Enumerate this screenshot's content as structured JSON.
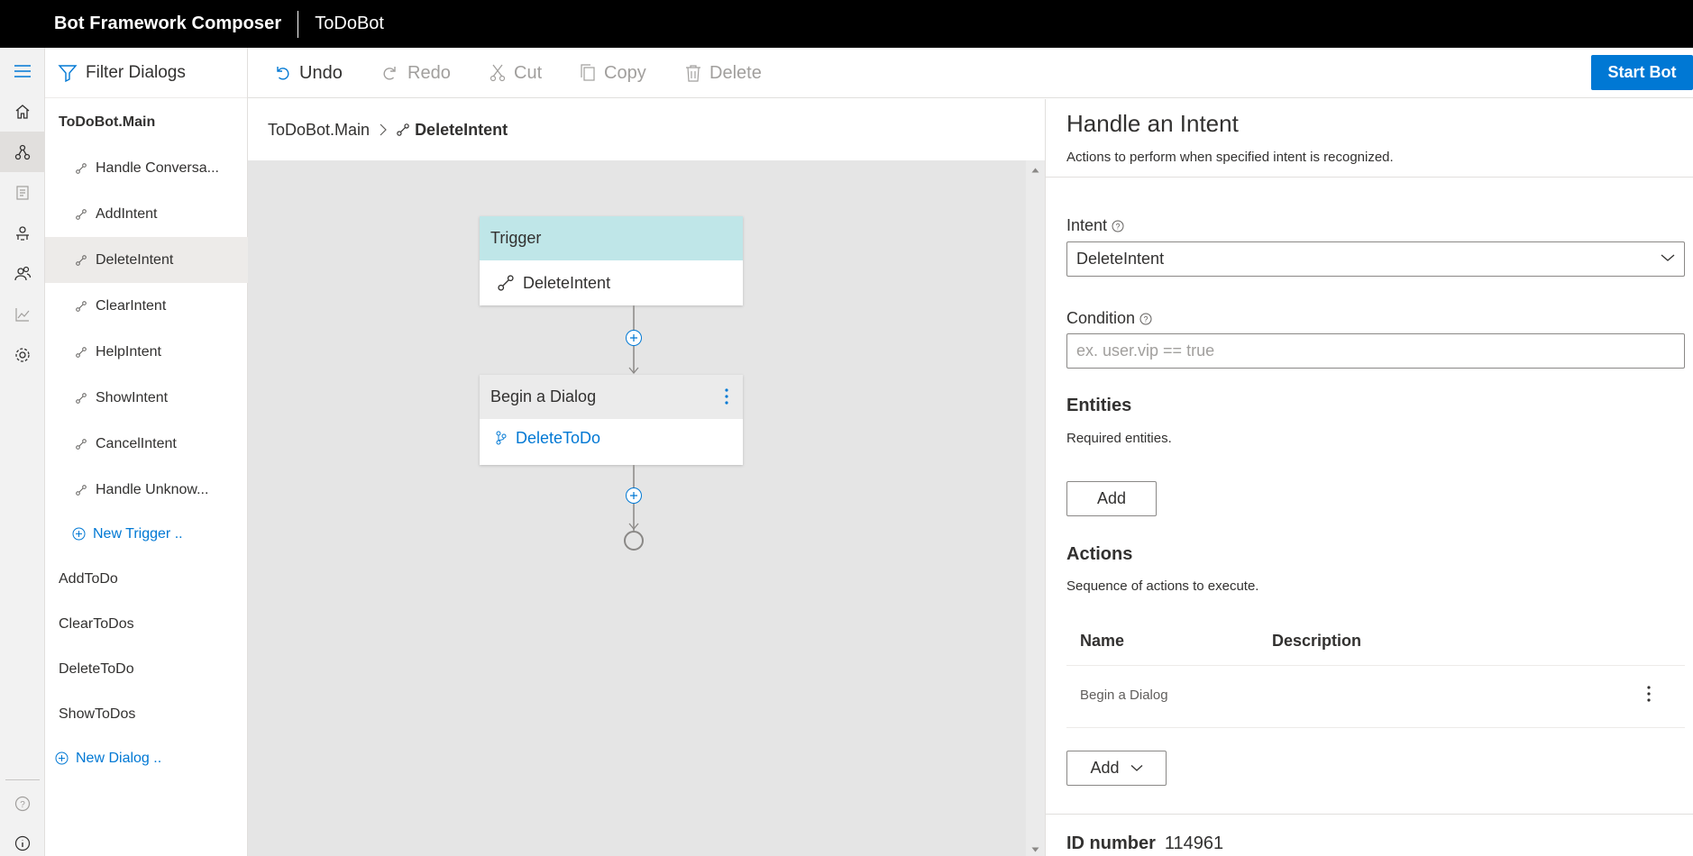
{
  "header": {
    "app_title": "Bot Framework Composer",
    "bot_name": "ToDoBot"
  },
  "rail": {
    "items": [
      "hamburger-icon",
      "home-icon",
      "flow-icon",
      "document-icon",
      "bot-icon",
      "users-icon",
      "analytics-icon",
      "settings-icon"
    ],
    "bottom": [
      "help-icon",
      "info-icon"
    ]
  },
  "tree": {
    "filter_label": "Filter Dialogs",
    "main_dialog": "ToDoBot.Main",
    "triggers": [
      "Handle Conversa...",
      "AddIntent",
      "DeleteIntent",
      "ClearIntent",
      "HelpIntent",
      "ShowIntent",
      "CancelIntent",
      "Handle Unknow..."
    ],
    "selected_trigger": "DeleteIntent",
    "new_trigger": "New Trigger ..",
    "dialogs": [
      "AddToDo",
      "ClearToDos",
      "DeleteToDo",
      "ShowToDos"
    ],
    "new_dialog": "New Dialog .."
  },
  "toolbar": {
    "undo": "Undo",
    "redo": "Redo",
    "cut": "Cut",
    "copy": "Copy",
    "delete": "Delete",
    "start_bot": "Start Bot"
  },
  "breadcrumb": {
    "root": "ToDoBot.Main",
    "current": "DeleteIntent"
  },
  "canvas": {
    "trigger_card": {
      "title": "Trigger",
      "body": "DeleteIntent"
    },
    "action_card": {
      "title": "Begin a Dialog",
      "body": "DeleteToDo"
    }
  },
  "pane": {
    "title": "Handle an Intent",
    "description": "Actions to perform when specified intent is recognized.",
    "intent_label": "Intent",
    "intent_value": "DeleteIntent",
    "condition_label": "Condition",
    "condition_placeholder": "ex. user.vip == true",
    "entities_title": "Entities",
    "entities_desc": "Required entities.",
    "entities_add": "Add",
    "actions_title": "Actions",
    "actions_desc": "Sequence of actions to execute.",
    "col_name": "Name",
    "col_description": "Description",
    "actions": [
      {
        "name": "Begin a Dialog"
      }
    ],
    "actions_add": "Add",
    "id_label": "ID number",
    "id_value": "114961"
  },
  "colors": {
    "accent": "#0078d4",
    "header_bg": "#000000",
    "trigger_header": "#bfe6e8",
    "canvas_bg": "#e5e5e5"
  }
}
